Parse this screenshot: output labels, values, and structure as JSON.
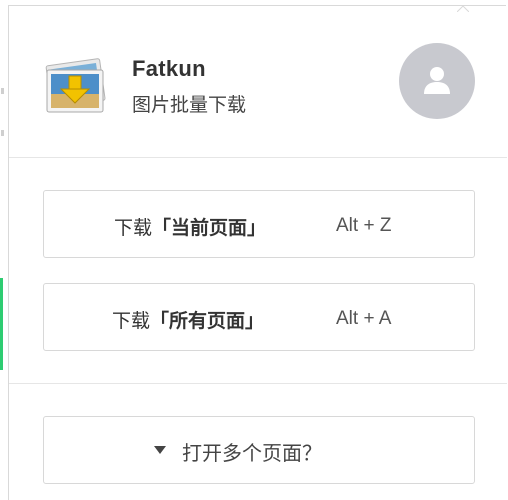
{
  "app": {
    "name": "Fatkun",
    "subtitle": "图片批量下载"
  },
  "icons": {
    "logo": "image-download-icon",
    "avatar": "user-avatar-icon",
    "dropdown": "triangle-down-icon"
  },
  "actions": {
    "download_current": {
      "prefix": "下载",
      "bracket_open": "「",
      "highlight": "当前页面",
      "bracket_close": "」",
      "shortcut": "Alt + Z"
    },
    "download_all": {
      "prefix": "下载",
      "bracket_open": "「",
      "highlight": "所有页面",
      "bracket_close": "」",
      "shortcut": "Alt + A"
    },
    "open_multiple": {
      "label": "打开多个页面？"
    }
  },
  "colors": {
    "avatar_bg": "#c8c9cf",
    "border": "#d8d8d8",
    "text": "#333333",
    "background_green": "#2ecc71"
  }
}
